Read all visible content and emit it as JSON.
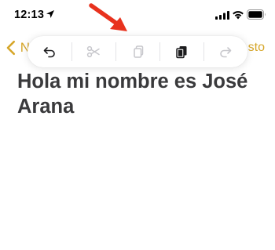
{
  "status_bar": {
    "time": "12:13",
    "icons": [
      "location-arrow-icon",
      "cellular-signal-icon",
      "wifi-icon",
      "battery-icon"
    ]
  },
  "nav": {
    "back_label": "N",
    "right_label": "sto",
    "accent_color": "#d6a629"
  },
  "toolbar": {
    "buttons": [
      {
        "name": "undo",
        "icon": "undo-icon",
        "enabled": true
      },
      {
        "name": "cut",
        "icon": "scissors-icon",
        "enabled": false
      },
      {
        "name": "copy",
        "icon": "copy-icon",
        "enabled": false
      },
      {
        "name": "paste",
        "icon": "paste-icon",
        "enabled": true
      },
      {
        "name": "redo",
        "icon": "redo-icon",
        "enabled": false
      }
    ]
  },
  "annotation": {
    "icon": "red-arrow-icon",
    "color": "#e8321e"
  },
  "note": {
    "title": "Hola mi nombre es José Arana"
  }
}
